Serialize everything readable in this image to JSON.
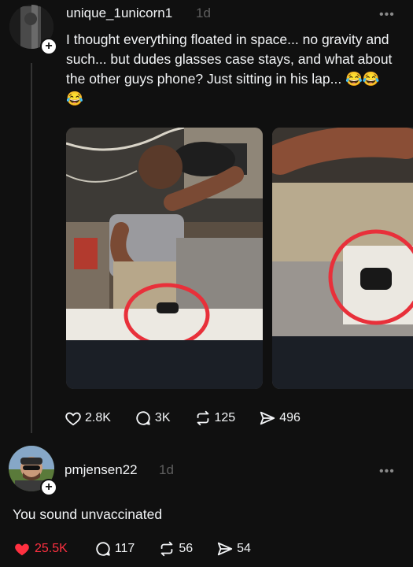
{
  "post": {
    "username": "unique_1unicorn1",
    "time": "1d",
    "text": "I thought everything floated in space... no gravity and such... but dudes glasses case stays, and what about the other guys phone? Just sitting in his lap... 😂😂😂",
    "actions": {
      "likes": "2.8K",
      "replies": "3K",
      "reposts": "125",
      "shares": "496"
    }
  },
  "reply": {
    "username": "pmjensen22",
    "time": "1d",
    "text": "You sound unvaccinated",
    "actions": {
      "likes": "25.5K",
      "replies": "117",
      "reposts": "56",
      "shares": "54"
    }
  },
  "colors": {
    "background": "#101010",
    "like_active": "#ff3040",
    "annotation_circle": "#e8303a"
  },
  "icons": [
    "plus-icon",
    "more-icon",
    "heart-icon",
    "reply-icon",
    "repost-icon",
    "share-icon"
  ]
}
